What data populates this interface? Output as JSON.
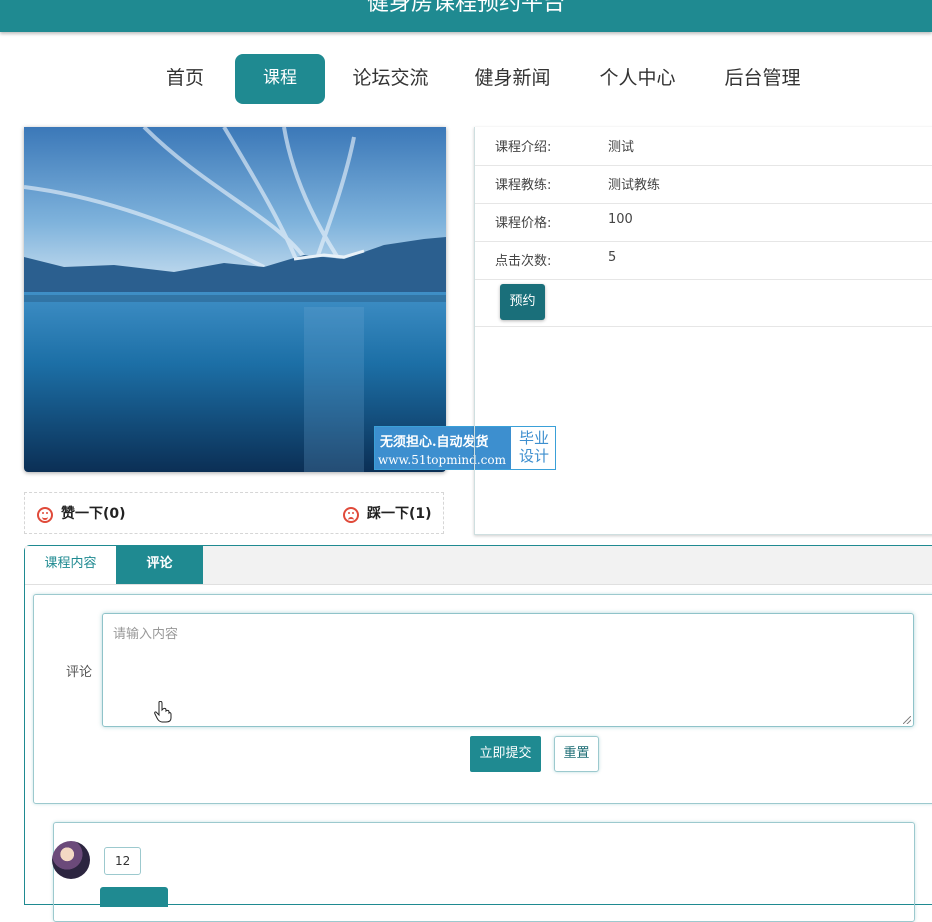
{
  "header": {
    "title": "健身房课程预约平台"
  },
  "nav": {
    "items": [
      {
        "label": "首页"
      },
      {
        "label": "课程"
      },
      {
        "label": "论坛交流"
      },
      {
        "label": "健身新闻"
      },
      {
        "label": "个人中心"
      },
      {
        "label": "后台管理"
      }
    ],
    "active_index": 1
  },
  "watermark": {
    "line1": "无须担心.自动发货",
    "line2": "www.51topmind.com",
    "right_top": "毕业",
    "right_bottom": "设计"
  },
  "votes": {
    "like": "赞一下(0)",
    "dislike": "踩一下(1)"
  },
  "course_info": {
    "rows": [
      {
        "label": "课程介绍:",
        "value": "测试"
      },
      {
        "label": "课程教练:",
        "value": "测试教练"
      },
      {
        "label": "课程价格:",
        "value": "100"
      },
      {
        "label": "点击次数:",
        "value": "5"
      }
    ],
    "book_button": "预约"
  },
  "tabs": {
    "content": "课程内容",
    "comments": "评论",
    "active": "comments"
  },
  "comment_form": {
    "label": "评论",
    "placeholder": "请输入内容",
    "submit": "立即提交",
    "reset": "重置"
  },
  "comments": [
    {
      "text": "12"
    }
  ],
  "colors": {
    "primary": "#1f8a91",
    "book_button": "#1a6f7a",
    "vote_icon": "#e04a3a",
    "watermark_blue": "#3d8fcf"
  }
}
